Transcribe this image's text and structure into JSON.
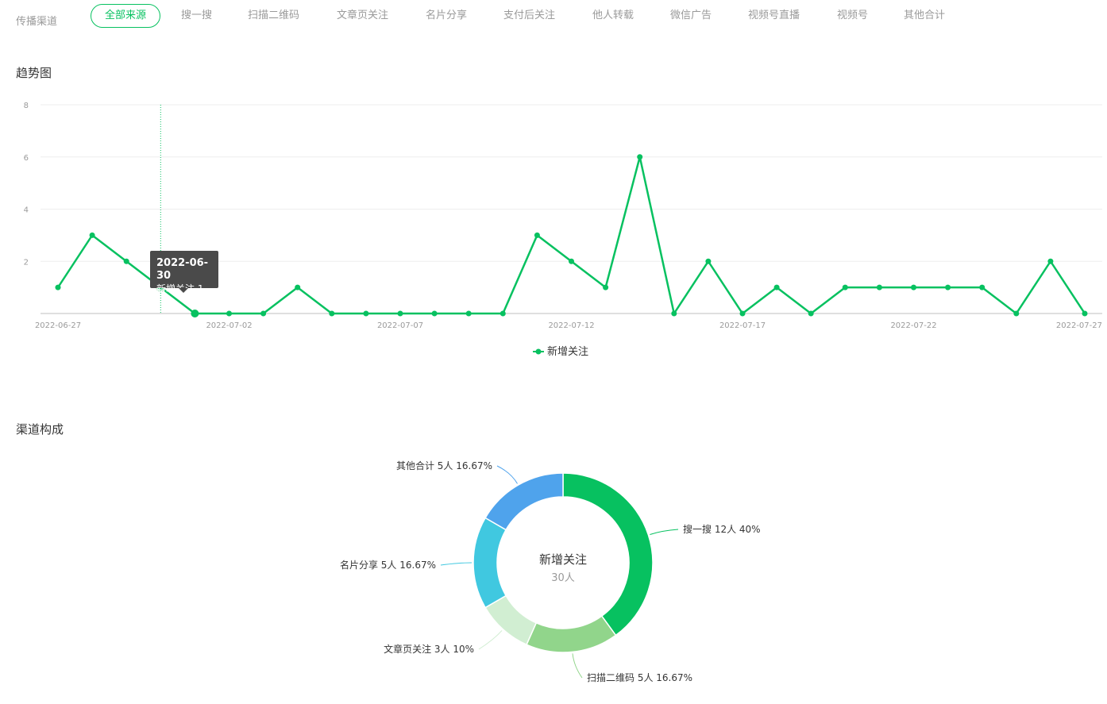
{
  "filters": {
    "label": "传播渠道",
    "tabs": [
      "全部来源",
      "搜一搜",
      "扫描二维码",
      "文章页关注",
      "名片分享",
      "支付后关注",
      "他人转载",
      "微信广告",
      "视频号直播",
      "视频号",
      "其他合计"
    ],
    "active": "全部来源"
  },
  "trend": {
    "title": "趋势图",
    "tooltip": {
      "date": "2022-06-30",
      "text": "新增关注 1"
    }
  },
  "composition": {
    "title": "渠道构成",
    "center_title": "新增关注",
    "center_value": "30人"
  },
  "colors": {
    "accent": "#07c160",
    "slice_search": "#07c160",
    "slice_qr": "#91d58b",
    "slice_article": "#d1eed2",
    "slice_card": "#40c8e0",
    "slice_other": "#4fa3ec"
  },
  "chart_data": [
    {
      "type": "line",
      "x": [
        "2022-06-27",
        "2022-06-28",
        "2022-06-29",
        "2022-06-30",
        "2022-07-01",
        "2022-07-02",
        "2022-07-03",
        "2022-07-04",
        "2022-07-05",
        "2022-07-06",
        "2022-07-07",
        "2022-07-08",
        "2022-07-09",
        "2022-07-10",
        "2022-07-11",
        "2022-07-12",
        "2022-07-13",
        "2022-07-14",
        "2022-07-15",
        "2022-07-16",
        "2022-07-17",
        "2022-07-18",
        "2022-07-19",
        "2022-07-20",
        "2022-07-21",
        "2022-07-22",
        "2022-07-23",
        "2022-07-24",
        "2022-07-25",
        "2022-07-26",
        "2022-07-27"
      ],
      "x_tick_labels": [
        "2022-06-27",
        "2022-07-02",
        "2022-07-07",
        "2022-07-12",
        "2022-07-17",
        "2022-07-22",
        "2022-07-27"
      ],
      "series": [
        {
          "name": "新增关注",
          "values": [
            1,
            3,
            2,
            1,
            0,
            0,
            0,
            1,
            0,
            0,
            0,
            0,
            0,
            0,
            3,
            2,
            1,
            6,
            0,
            2,
            0,
            1,
            0,
            1,
            1,
            1,
            1,
            1,
            0,
            2,
            0
          ]
        }
      ],
      "y_ticks": [
        2,
        4,
        6,
        8
      ],
      "ylim": [
        0,
        8
      ],
      "grid": true,
      "legend": "bottom-center"
    },
    {
      "type": "pie",
      "categories": [
        "搜一搜",
        "扫描二维码",
        "文章页关注",
        "名片分享",
        "其他合计"
      ],
      "values": [
        12,
        5,
        3,
        5,
        5
      ],
      "labels": [
        "搜一搜 12人 40%",
        "扫描二维码 5人 16.67%",
        "文章页关注 3人 10%",
        "名片分享 5人 16.67%",
        "其他合计 5人 16.67%"
      ]
    }
  ]
}
